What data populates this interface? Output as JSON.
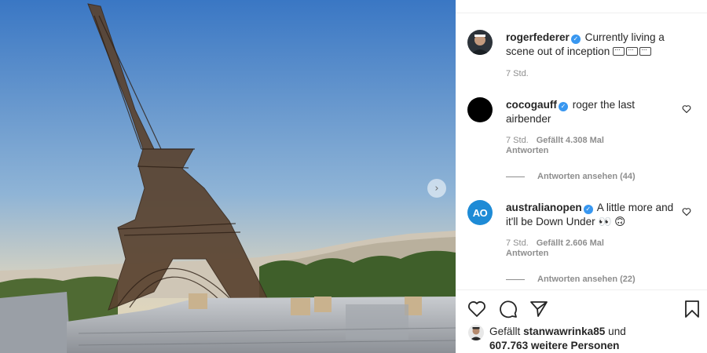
{
  "post": {
    "caption_user": "rogerfederer",
    "caption_text": "Currently living a scene out of inception",
    "caption_time": "7 Std."
  },
  "comments": [
    {
      "user": "cocogauff",
      "text": "roger the last airbender",
      "time": "7 Std.",
      "likes": "Gefällt 4.308 Mal",
      "reply": "Antworten",
      "view_replies": "Antworten ansehen (44)"
    },
    {
      "user": "australianopen",
      "avatar_text": "AO",
      "text": "A little more and it'll be Down Under",
      "emoji": "👀 🙃",
      "time": "7 Std.",
      "likes": "Gefällt 2.606 Mal",
      "reply": "Antworten",
      "view_replies": "Antworten ansehen (22)"
    }
  ],
  "likes_summary": {
    "prefix": "Gefällt",
    "user": "stanwawrinka85",
    "middle": "und",
    "count": "607.763 weitere Personen"
  },
  "icons": {
    "verified": "verified-badge-icon",
    "next": "chevron-right-icon",
    "like": "heart-icon",
    "comment": "comment-bubble-icon",
    "share": "paper-plane-icon",
    "save": "bookmark-icon"
  },
  "colors": {
    "verified": "#3897f0",
    "muted": "#8e8e8e",
    "text": "#262626",
    "ao_brand": "#1e8bd6"
  }
}
